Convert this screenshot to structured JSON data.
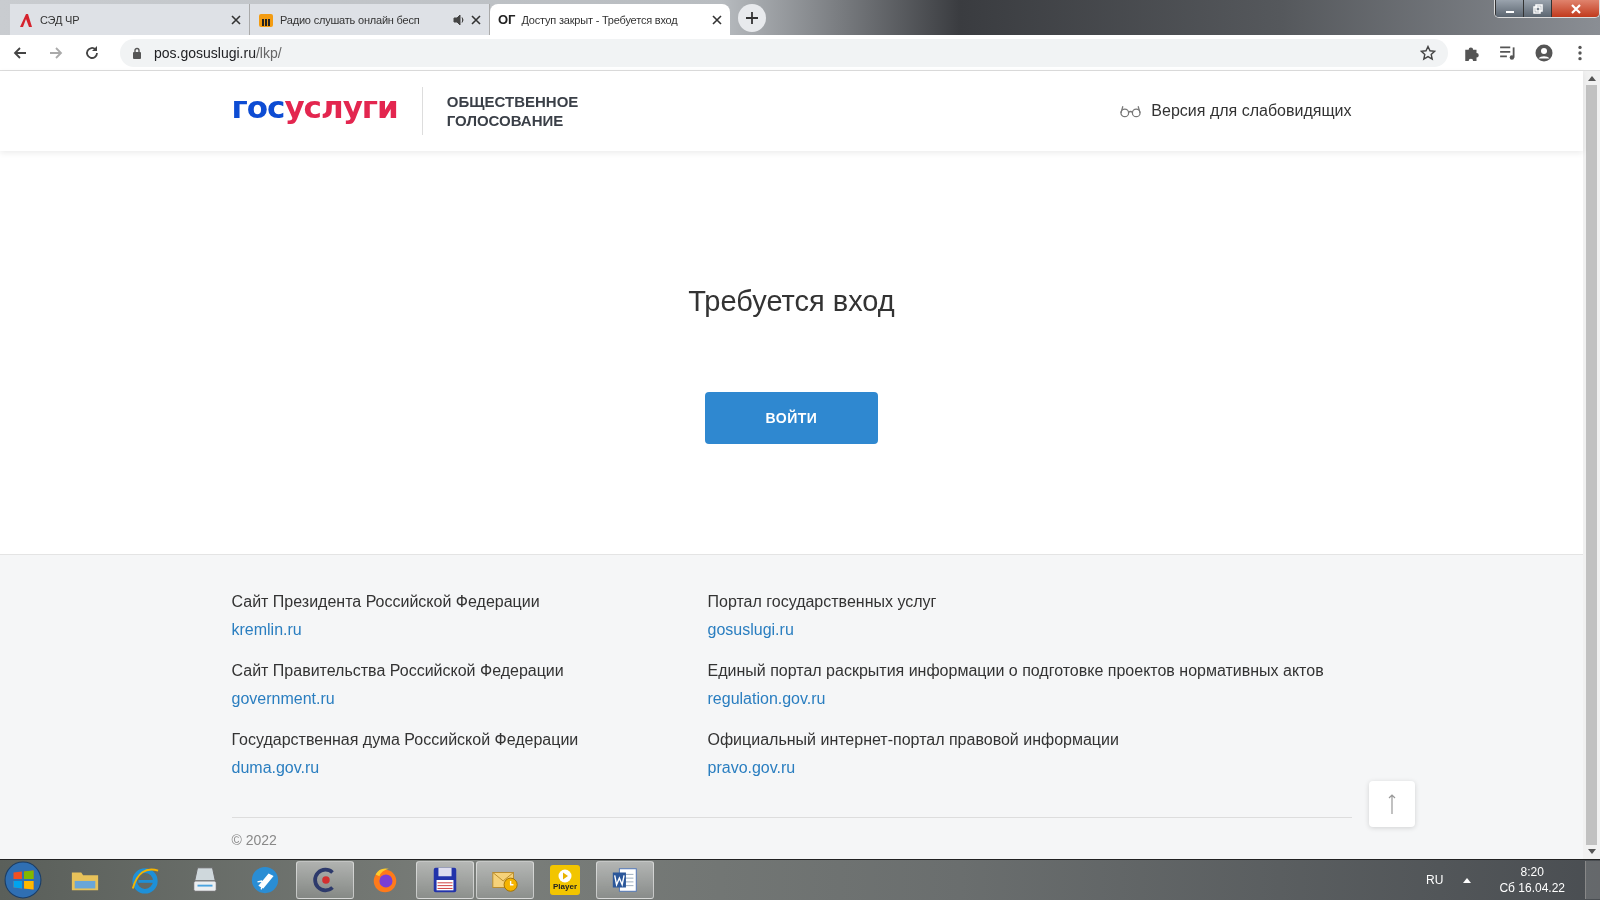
{
  "browser": {
    "tabs": [
      {
        "title": "СЭД ЧР",
        "kind": "sed",
        "audio": false,
        "selected": false
      },
      {
        "title": "Радио слушать онлайн бесп",
        "kind": "radio",
        "audio": true,
        "selected": false
      },
      {
        "title": "Доступ закрыт - Требуется вход",
        "kind": "og",
        "favicon_text": "ОГ",
        "audio": false,
        "selected": true
      }
    ],
    "url_host": "pos.gosuslugi.ru",
    "url_path": "/lkp/"
  },
  "header": {
    "logo_first": "гос",
    "logo_second": "услуги",
    "subtitle_line1": "ОБЩЕСТВЕННОЕ",
    "subtitle_line2": "ГОЛОСОВАНИЕ",
    "accessibility_link": "Версия для слабовидящих"
  },
  "main": {
    "title": "Требуется вход",
    "button": "ВОЙТИ"
  },
  "footer": {
    "links": [
      {
        "caption": "Сайт Президента Российской Федерации",
        "link": "kremlin.ru"
      },
      {
        "caption": "Портал государственных услуг",
        "link": "gosuslugi.ru"
      },
      {
        "caption": "Сайт Правительства Российской Федерации",
        "link": "government.ru"
      },
      {
        "caption": "Единый портал раскрытия информации о подготовке проектов нормативных актов",
        "link": "regulation.gov.ru"
      },
      {
        "caption": "Государственная дума Российской Федерации",
        "link": "duma.gov.ru"
      },
      {
        "caption": "Официальный интернет-портал правовой информации",
        "link": "pravo.gov.ru"
      }
    ],
    "copyright": "© 2022"
  },
  "taskbar": {
    "items": [
      {
        "kind": "explorer",
        "open": false
      },
      {
        "kind": "ie",
        "open": false
      },
      {
        "kind": "scanner",
        "open": false
      },
      {
        "kind": "rocket",
        "open": false
      },
      {
        "kind": "c",
        "open": true
      },
      {
        "kind": "firefox",
        "open": false
      },
      {
        "kind": "floppy",
        "open": true
      },
      {
        "kind": "outlook",
        "open": true
      },
      {
        "kind": "player",
        "open": false,
        "label": "Player"
      },
      {
        "kind": "word",
        "open": true
      }
    ],
    "language": "RU",
    "time": "8:20",
    "date": "Сб 16.04.22"
  }
}
